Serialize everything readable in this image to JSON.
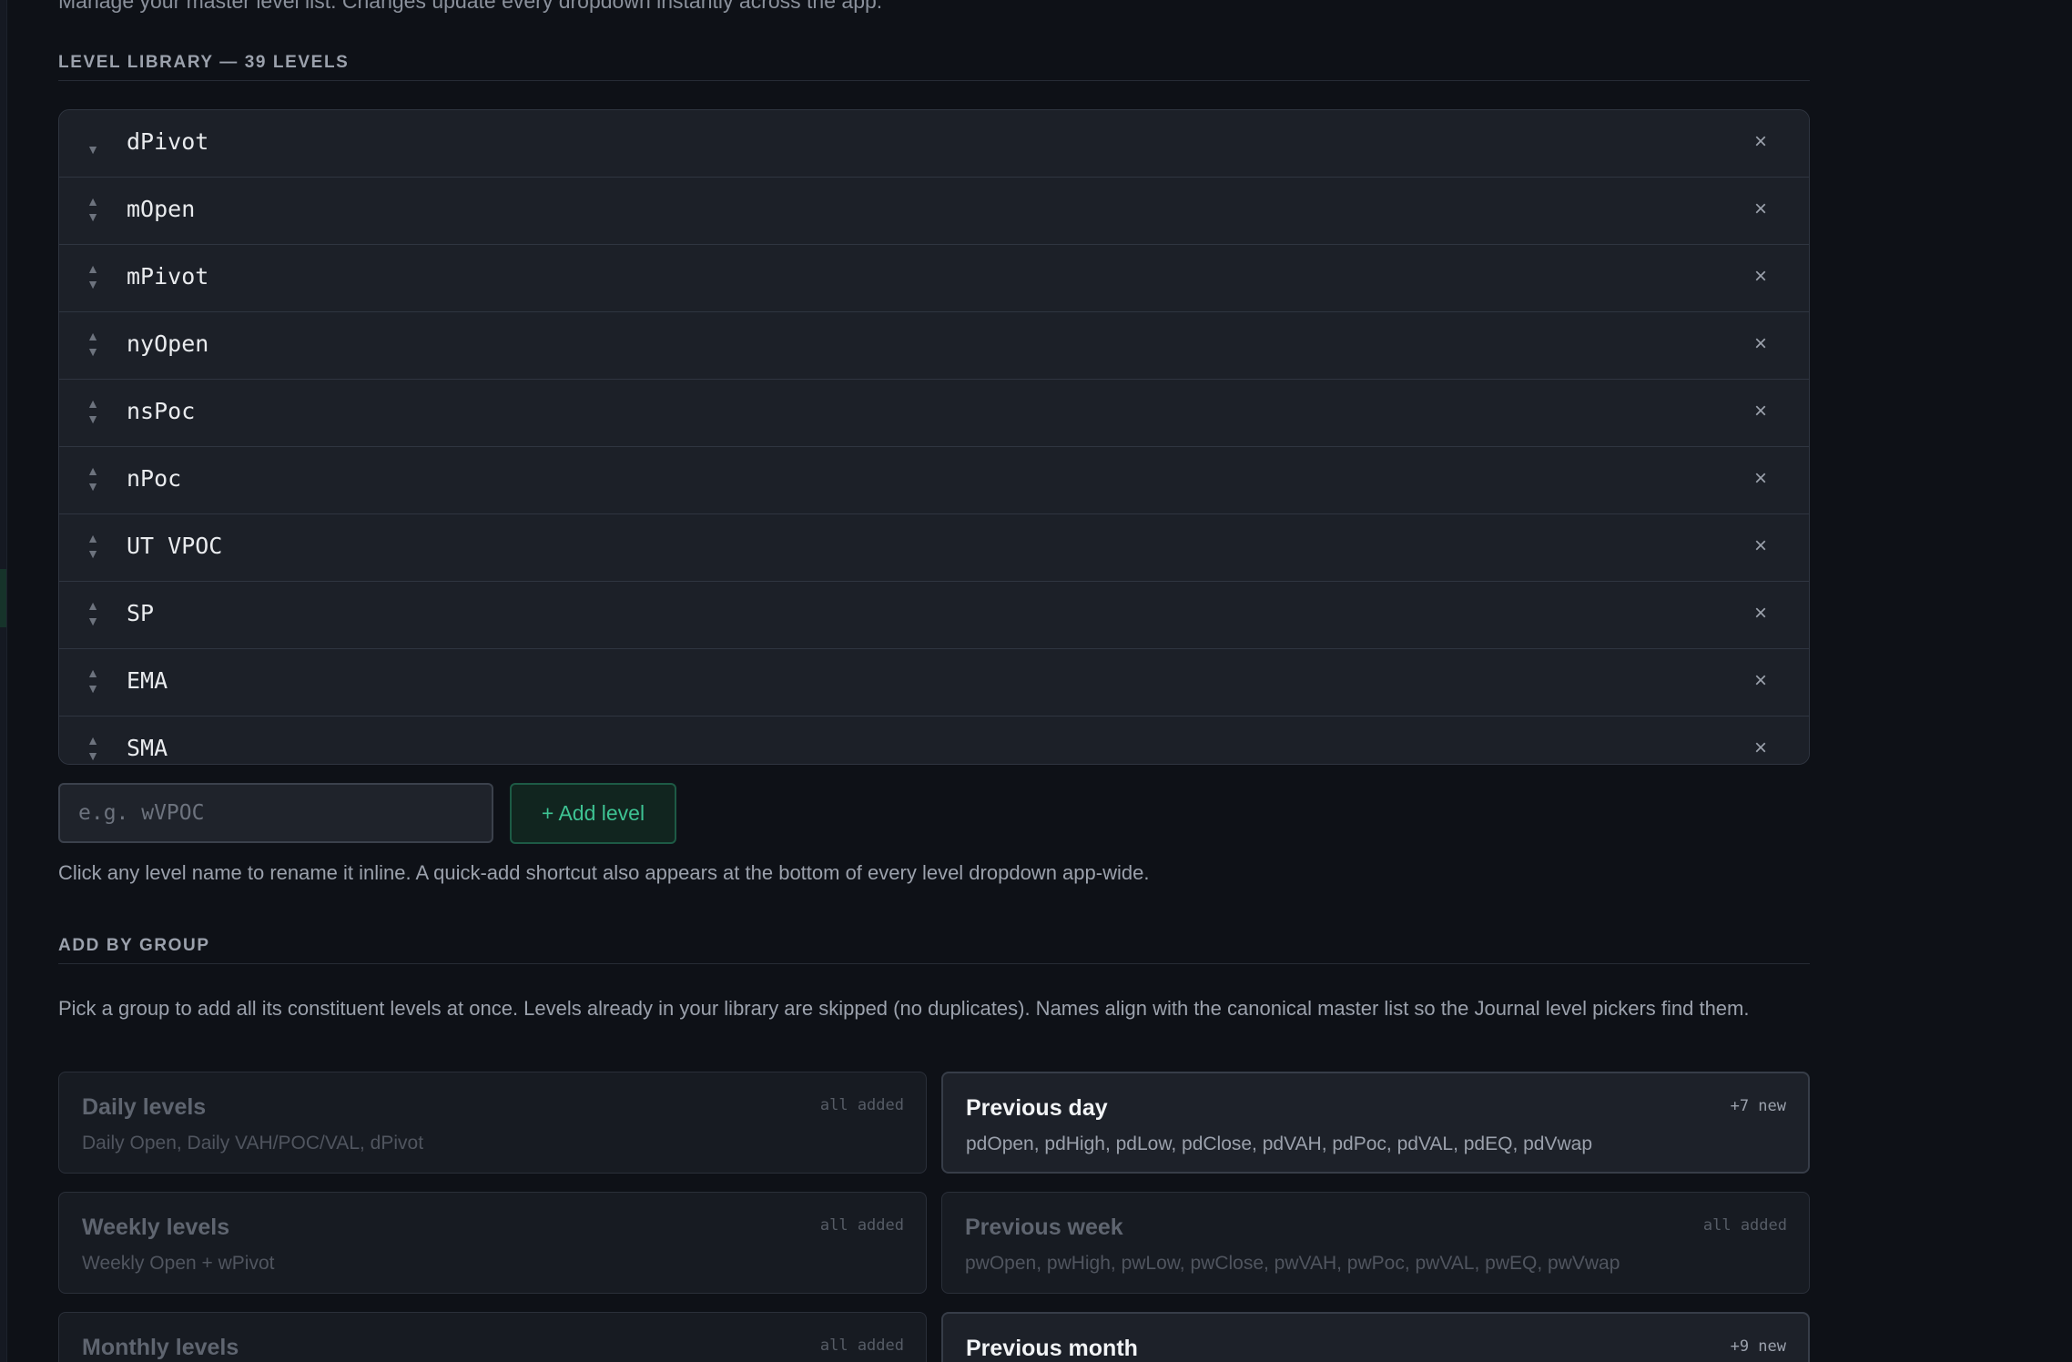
{
  "intro": "Manage your master level list. Changes update every dropdown instantly across the app.",
  "library": {
    "heading": "LEVEL LIBRARY — 39 LEVELS",
    "rows": [
      {
        "name": "dPivot"
      },
      {
        "name": "mOpen"
      },
      {
        "name": "mPivot"
      },
      {
        "name": "nyOpen"
      },
      {
        "name": "nsPoc"
      },
      {
        "name": "nPoc"
      },
      {
        "name": "UT VPOC"
      },
      {
        "name": "SP"
      },
      {
        "name": "EMA"
      },
      {
        "name": "SMA"
      }
    ],
    "up_arrow": "▲",
    "down_arrow": "▼",
    "remove_glyph": "×",
    "add_placeholder": "e.g. wVPOC",
    "add_button": "+ Add level",
    "hint": "Click any level name to rename it inline. A quick-add shortcut also appears at the bottom of every level dropdown app-wide."
  },
  "groups": {
    "heading": "ADD BY GROUP",
    "description": "Pick a group to add all its constituent levels at once. Levels already in your library are skipped (no duplicates). Names align with the canonical master list so the Journal level pickers find them.",
    "cards": [
      {
        "title": "Daily levels",
        "status": "all added",
        "items": "Daily Open, Daily VAH/POC/VAL, dPivot",
        "active": false
      },
      {
        "title": "Previous day",
        "status": "+7 new",
        "items": "pdOpen, pdHigh, pdLow, pdClose, pdVAH, pdPoc, pdVAL, pdEQ, pdVwap",
        "active": true
      },
      {
        "title": "Weekly levels",
        "status": "all added",
        "items": "Weekly Open + wPivot",
        "active": false
      },
      {
        "title": "Previous week",
        "status": "all added",
        "items": "pwOpen, pwHigh, pwLow, pwClose, pwVAH, pwPoc, pwVAL, pwEQ, pwVwap",
        "active": false
      },
      {
        "title": "Monthly levels",
        "status": "all added",
        "items": "",
        "active": false
      },
      {
        "title": "Previous month",
        "status": "+9 new",
        "items": "",
        "active": true
      }
    ]
  },
  "colors": {
    "background": "#0e1117",
    "accent_green": "#3ec393",
    "panel": "#1c2028"
  }
}
